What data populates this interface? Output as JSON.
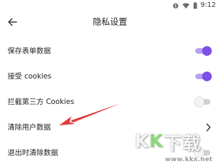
{
  "status_bar": {
    "time": "9:12",
    "icons": [
      "signal-icon",
      "wifi-icon",
      "battery-icon"
    ]
  },
  "header": {
    "title": "隐私设置",
    "back_icon": "back-arrow-icon"
  },
  "settings": [
    {
      "label": "保存表单数据",
      "control": "toggle",
      "on": true
    },
    {
      "label": "接受 cookies",
      "control": "toggle",
      "on": true
    },
    {
      "label": "拦截第三方 Cookies",
      "control": "toggle",
      "on": false
    },
    {
      "label": "清除用户数据",
      "control": "chevron"
    },
    {
      "label": "退出时清除数据",
      "control": "toggle",
      "on": false
    }
  ],
  "colors": {
    "accent": "#7d4fe6",
    "accent_track": "#b7a2ee",
    "annotation_arrow": "#e23b3b"
  },
  "watermark": {
    "chars": [
      "K",
      "K",
      "下",
      "载"
    ],
    "url": "www.kkx.net"
  }
}
